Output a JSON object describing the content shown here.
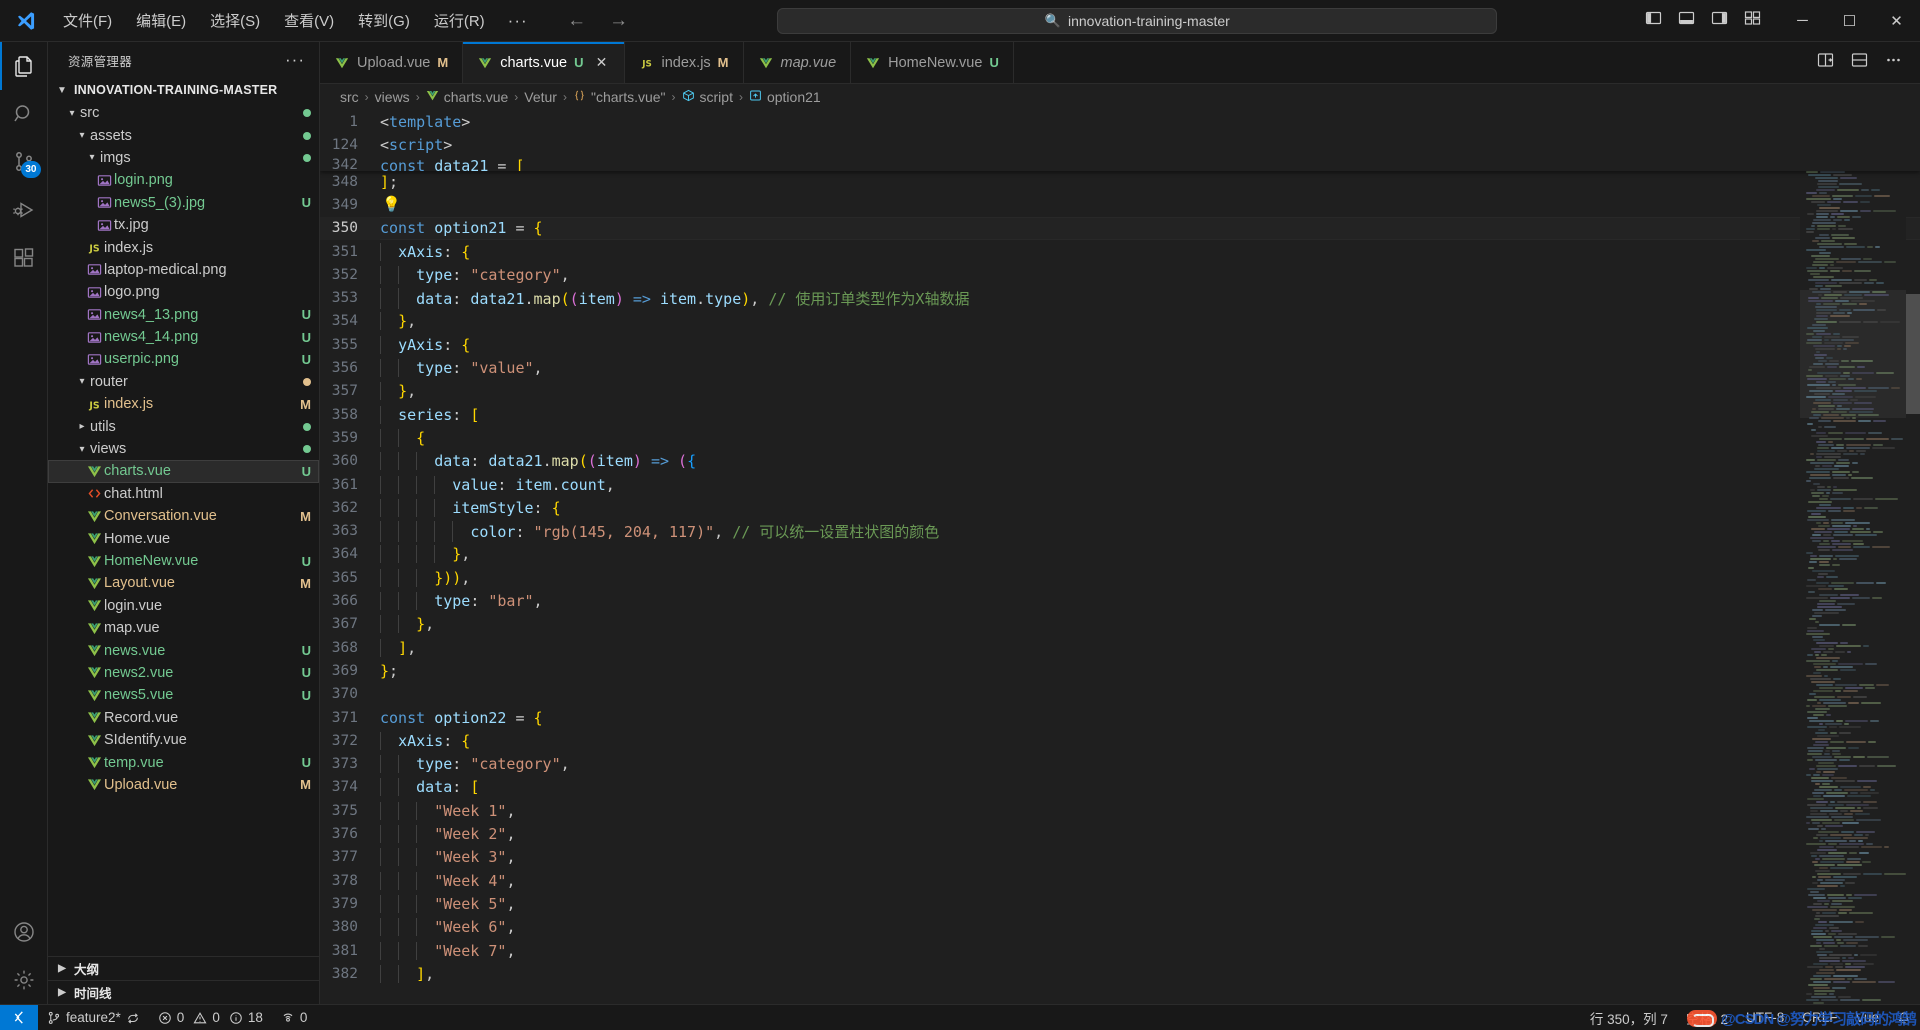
{
  "titlebar": {
    "menus": [
      "文件(F)",
      "编辑(E)",
      "选择(S)",
      "查看(V)",
      "转到(G)",
      "运行(R)"
    ],
    "more": "···",
    "nav_back": "←",
    "nav_forward": "→",
    "search_query": "innovation-training-master",
    "search_icon": "search-icon",
    "window_minimize": "─",
    "window_maximize": "☐",
    "window_close": "✕"
  },
  "activitybar": {
    "items": [
      {
        "name": "explorer",
        "active": true
      },
      {
        "name": "search",
        "active": false
      },
      {
        "name": "source-control",
        "active": false,
        "badge": "30"
      },
      {
        "name": "run-and-debug",
        "active": false
      },
      {
        "name": "extensions",
        "active": false
      }
    ],
    "bottom": [
      {
        "name": "accounts"
      },
      {
        "name": "manage-settings"
      }
    ]
  },
  "sidebar": {
    "title": "资源管理器",
    "more_label": "···",
    "root_folder": "INNOVATION-TRAINING-MASTER",
    "tree": [
      {
        "label": "src",
        "indent": 1,
        "kind": "folder",
        "expanded": true,
        "mark": "",
        "dot": "#73c991"
      },
      {
        "label": "assets",
        "indent": 2,
        "kind": "folder",
        "expanded": true,
        "mark": "",
        "dot": "#73c991"
      },
      {
        "label": "imgs",
        "indent": 3,
        "kind": "folder",
        "expanded": true,
        "mark": "",
        "dot": "#73c991"
      },
      {
        "label": "login.png",
        "indent": 4,
        "kind": "image",
        "mark": "",
        "color": "c-vue-green"
      },
      {
        "label": "news5_(3).jpg",
        "indent": 4,
        "kind": "image",
        "mark": "U",
        "color": "c-vue-green"
      },
      {
        "label": "tx.jpg",
        "indent": 4,
        "kind": "image",
        "mark": "",
        "color": "c-plain"
      },
      {
        "label": "index.js",
        "indent": 3,
        "kind": "js",
        "mark": "",
        "color": "c-plain"
      },
      {
        "label": "laptop-medical.png",
        "indent": 3,
        "kind": "image",
        "mark": "",
        "color": "c-plain"
      },
      {
        "label": "logo.png",
        "indent": 3,
        "kind": "image",
        "mark": "",
        "color": "c-plain"
      },
      {
        "label": "news4_13.png",
        "indent": 3,
        "kind": "image",
        "mark": "U",
        "color": "c-vue-green"
      },
      {
        "label": "news4_14.png",
        "indent": 3,
        "kind": "image",
        "mark": "U",
        "color": "c-vue-green"
      },
      {
        "label": "userpic.png",
        "indent": 3,
        "kind": "image",
        "mark": "U",
        "color": "c-vue-green"
      },
      {
        "label": "router",
        "indent": 2,
        "kind": "folder",
        "expanded": true,
        "mark": "",
        "dot": "#e2c08d"
      },
      {
        "label": "index.js",
        "indent": 3,
        "kind": "js",
        "mark": "M",
        "color": "c-vue-mod"
      },
      {
        "label": "utils",
        "indent": 2,
        "kind": "folder",
        "expanded": false,
        "mark": "",
        "dot": "#73c991"
      },
      {
        "label": "views",
        "indent": 2,
        "kind": "folder",
        "expanded": true,
        "mark": "",
        "dot": "#73c991"
      },
      {
        "label": "charts.vue",
        "indent": 3,
        "kind": "vue",
        "mark": "U",
        "color": "c-vue-green",
        "selected": true
      },
      {
        "label": "chat.html",
        "indent": 3,
        "kind": "html",
        "mark": "",
        "color": "c-plain"
      },
      {
        "label": "Conversation.vue",
        "indent": 3,
        "kind": "vue",
        "mark": "M",
        "color": "c-vue-mod"
      },
      {
        "label": "Home.vue",
        "indent": 3,
        "kind": "vue",
        "mark": "",
        "color": "c-plain"
      },
      {
        "label": "HomeNew.vue",
        "indent": 3,
        "kind": "vue",
        "mark": "U",
        "color": "c-vue-green"
      },
      {
        "label": "Layout.vue",
        "indent": 3,
        "kind": "vue",
        "mark": "M",
        "color": "c-vue-mod"
      },
      {
        "label": "login.vue",
        "indent": 3,
        "kind": "vue",
        "mark": "",
        "color": "c-plain"
      },
      {
        "label": "map.vue",
        "indent": 3,
        "kind": "vue",
        "mark": "",
        "color": "c-plain"
      },
      {
        "label": "news.vue",
        "indent": 3,
        "kind": "vue",
        "mark": "U",
        "color": "c-vue-green"
      },
      {
        "label": "news2.vue",
        "indent": 3,
        "kind": "vue",
        "mark": "U",
        "color": "c-vue-green"
      },
      {
        "label": "news5.vue",
        "indent": 3,
        "kind": "vue",
        "mark": "U",
        "color": "c-vue-green"
      },
      {
        "label": "Record.vue",
        "indent": 3,
        "kind": "vue",
        "mark": "",
        "color": "c-plain"
      },
      {
        "label": "SIdentify.vue",
        "indent": 3,
        "kind": "vue",
        "mark": "",
        "color": "c-plain"
      },
      {
        "label": "temp.vue",
        "indent": 3,
        "kind": "vue",
        "mark": "U",
        "color": "c-vue-green"
      },
      {
        "label": "Upload.vue",
        "indent": 3,
        "kind": "vue",
        "mark": "M",
        "color": "c-vue-mod"
      }
    ],
    "sections": [
      {
        "label": "大纲",
        "expanded": false
      },
      {
        "label": "时间线",
        "expanded": false
      }
    ]
  },
  "tabs": [
    {
      "label": "Upload.vue",
      "icon": "vue-icon",
      "mark": "M",
      "active": false,
      "preview": false,
      "close": false
    },
    {
      "label": "charts.vue",
      "icon": "vue-icon",
      "mark": "U",
      "active": true,
      "preview": false,
      "close": true,
      "close_glyph": "✕"
    },
    {
      "label": "index.js",
      "icon": "js-icon",
      "mark": "M",
      "active": false,
      "preview": false,
      "close": false
    },
    {
      "label": "map.vue",
      "icon": "vue-icon",
      "mark": "",
      "active": false,
      "preview": true,
      "close": false
    },
    {
      "label": "HomeNew.vue",
      "icon": "vue-icon",
      "mark": "U",
      "active": false,
      "preview": false,
      "close": false
    }
  ],
  "editor_actions": [
    "split-editor-icon",
    "split-editor-down-icon",
    "more-actions-icon"
  ],
  "breadcrumb": [
    {
      "label": "src",
      "icon": ""
    },
    {
      "label": "views",
      "icon": ""
    },
    {
      "label": "charts.vue",
      "icon": "vue-icon"
    },
    {
      "label": "Vetur",
      "icon": ""
    },
    {
      "label": "\"charts.vue\"",
      "icon": "braces-icon"
    },
    {
      "label": "script",
      "icon": "cube-icon"
    },
    {
      "label": "option21",
      "icon": "symbol-icon"
    }
  ],
  "sticky_lines": [
    {
      "num": "1",
      "text": "<template>"
    },
    {
      "num": "124",
      "text": "<script>"
    },
    {
      "num": "342",
      "text": "const data21 = ["
    }
  ],
  "code_lines": [
    {
      "num": "348",
      "indents": 0
    },
    {
      "num": "349",
      "indents": 0
    },
    {
      "num": "350",
      "indents": 0,
      "current": true
    },
    {
      "num": "351",
      "indents": 1
    },
    {
      "num": "352",
      "indents": 2
    },
    {
      "num": "353",
      "indents": 2
    },
    {
      "num": "354",
      "indents": 1
    },
    {
      "num": "355",
      "indents": 1
    },
    {
      "num": "356",
      "indents": 2
    },
    {
      "num": "357",
      "indents": 1
    },
    {
      "num": "358",
      "indents": 1
    },
    {
      "num": "359",
      "indents": 2
    },
    {
      "num": "360",
      "indents": 3
    },
    {
      "num": "361",
      "indents": 4
    },
    {
      "num": "362",
      "indents": 4
    },
    {
      "num": "363",
      "indents": 5
    },
    {
      "num": "364",
      "indents": 4
    },
    {
      "num": "365",
      "indents": 3
    },
    {
      "num": "366",
      "indents": 3
    },
    {
      "num": "367",
      "indents": 2
    },
    {
      "num": "368",
      "indents": 1
    },
    {
      "num": "369",
      "indents": 0
    },
    {
      "num": "370",
      "indents": 0
    },
    {
      "num": "371",
      "indents": 0
    },
    {
      "num": "372",
      "indents": 1
    },
    {
      "num": "373",
      "indents": 2
    },
    {
      "num": "374",
      "indents": 2
    },
    {
      "num": "375",
      "indents": 3
    },
    {
      "num": "376",
      "indents": 3
    },
    {
      "num": "377",
      "indents": 3
    },
    {
      "num": "378",
      "indents": 3
    },
    {
      "num": "379",
      "indents": 3
    },
    {
      "num": "380",
      "indents": 3
    },
    {
      "num": "381",
      "indents": 3
    },
    {
      "num": "382",
      "indents": 2
    }
  ],
  "code_text": {
    "l348": "];",
    "l349": "",
    "l350": "const option21 = {",
    "l351": "  xAxis: {",
    "l352": "    type: \"category\",",
    "l353": "    data: data21.map((item) => item.type), // 使用订单类型作为X轴数据",
    "l354": "  },",
    "l355": "  yAxis: {",
    "l356": "    type: \"value\",",
    "l357": "  },",
    "l358": "  series: [",
    "l359": "    {",
    "l360": "      data: data21.map((item) => ({",
    "l361": "        value: item.count,",
    "l362": "        itemStyle: {",
    "l363": "          color: \"rgb(145, 204, 117)\", // 可以统一设置柱状图的颜色",
    "l364": "        },",
    "l365": "      })),",
    "l366": "      type: \"bar\",",
    "l367": "    },",
    "l368": "  ],",
    "l369": "};",
    "l370": "",
    "l371": "const option22 = {",
    "l372": "  xAxis: {",
    "l373": "    type: \"category\",",
    "l374": "    data: [",
    "l375": "      \"Week 1\",",
    "l376": "      \"Week 2\",",
    "l377": "      \"Week 3\",",
    "l378": "      \"Week 4\",",
    "l379": "      \"Week 5\",",
    "l380": "      \"Week 6\",",
    "l381": "      \"Week 7\",",
    "l382": "    ],"
  },
  "statusbar": {
    "remote_icon": "remote-window-icon",
    "branch": "feature2*",
    "sync_icon": "sync-icon",
    "errors": "0",
    "warnings": "0",
    "infos": "18",
    "ports": "0",
    "cursor_position": "行 350，列 7",
    "indentation": "空格: 2",
    "encoding": "UTF-8",
    "eol": "CRLF",
    "language": "Vue",
    "bell_icon": "bell-icon",
    "watermark": "@CSDN @努力学习敲码的鸿鹄"
  }
}
